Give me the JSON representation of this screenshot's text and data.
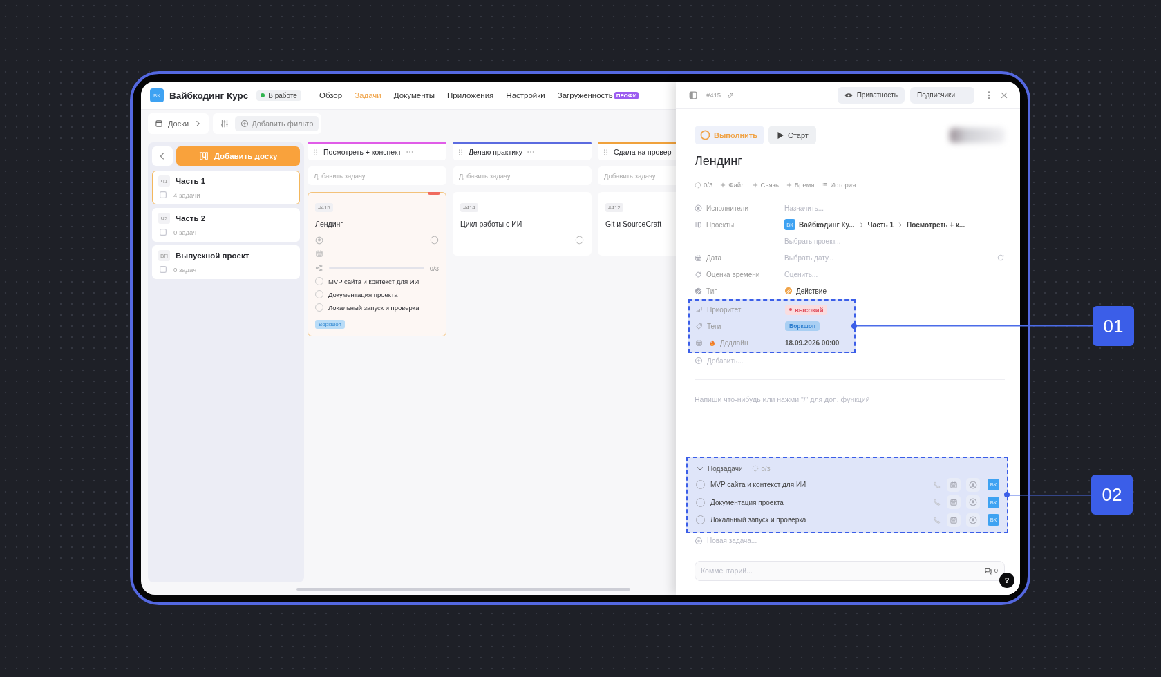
{
  "app": {
    "logo": "ВК",
    "title": "Вайбкодинг Курс",
    "status": "В работе",
    "nav": [
      {
        "label": "Обзор",
        "selected": false
      },
      {
        "label": "Задачи",
        "selected": true
      },
      {
        "label": "Документы",
        "selected": false
      },
      {
        "label": "Приложения",
        "selected": false
      },
      {
        "label": "Настройки",
        "selected": false
      },
      {
        "label": "Загруженность",
        "selected": false,
        "badge": "ПРОФИ"
      }
    ]
  },
  "toolbar": {
    "boards": "Доски",
    "add_filter": "Добавить фильтр"
  },
  "sidebar": {
    "add_board": "Добавить доску",
    "boards": [
      {
        "abbr": "Ч1",
        "name": "Часть 1",
        "count": "4 задачи",
        "selected": true
      },
      {
        "abbr": "Ч2",
        "name": "Часть 2",
        "count": "0 задач",
        "selected": false
      },
      {
        "abbr": "ВП",
        "name": "Выпускной проект",
        "count": "0 задач",
        "selected": false
      }
    ]
  },
  "columns": [
    {
      "title": "Посмотреть + конспект",
      "color": "#e05ce8",
      "add_task": "Добавить задачу",
      "cards": [
        {
          "id": "#415",
          "title": "Лендинг",
          "selected": true,
          "progress": "0/3",
          "level": 0,
          "subtasks": [
            {
              "title": "MVP сайта и контекст для ИИ",
              "checked": false
            },
            {
              "title": "Документация проекта",
              "checked": false
            },
            {
              "title": "Локальный запуск и проверка",
              "checked": false
            }
          ],
          "tag": "Воркшоп"
        }
      ]
    },
    {
      "title": "Делаю практику",
      "color": "#5b6be0",
      "add_task": "Добавить задачу",
      "cards": [
        {
          "id": "#414",
          "title": "Цикл работы с ИИ",
          "selected": false
        }
      ]
    },
    {
      "title": "Сдала на провер",
      "color": "#f0a23c",
      "add_task": "Добавить задачу",
      "cards": [
        {
          "id": "#412",
          "title": "Git и SourceCraft",
          "selected": false
        }
      ]
    }
  ],
  "detail": {
    "id": "#415",
    "privacy": "Приватность",
    "subscribers": "Подписчики",
    "complete": "Выполнить",
    "start": "Старт",
    "title": "Лендинг",
    "actions": [
      {
        "kind": "progress",
        "label": "0/3"
      },
      {
        "kind": "add",
        "label": "Файл"
      },
      {
        "kind": "add",
        "label": "Связь"
      },
      {
        "kind": "add",
        "label": "Время"
      },
      {
        "kind": "history",
        "label": "История"
      }
    ],
    "properties": [
      {
        "kind": "assignees",
        "label": "Исполнители",
        "value": "Назначить...",
        "empty": true
      },
      {
        "kind": "projects",
        "label": "Проекты",
        "logo": "ВК",
        "path": [
          "Вайбкодинг Ку...",
          "Часть 1",
          "Посмотреть + к..."
        ],
        "extra": "Выбрать проект..."
      },
      {
        "kind": "date",
        "label": "Дата",
        "value": "Выбрать дату...",
        "empty": true
      },
      {
        "kind": "estimate",
        "label": "Оценка времени",
        "value": "Оценить...",
        "empty": true
      },
      {
        "kind": "type",
        "label": "Тип",
        "value": "Действие",
        "empty": false
      }
    ],
    "callout_group": {
      "callout": "01",
      "properties": [
        {
          "kind": "priority",
          "label": "Приоритет",
          "value": "высокий"
        },
        {
          "kind": "tags",
          "label": "Теги",
          "value": "Воркшоп"
        },
        {
          "kind": "deadline",
          "label": "Дедлайн",
          "value": "18.09.2026 00:00"
        }
      ]
    },
    "add_property": "Добавить...",
    "editor": {
      "placeholder": "Напиши что-нибудь или нажми \"/\" для доп. функций"
    },
    "subtasks": {
      "callout": "02",
      "title": "Подзадачи",
      "expanded": true,
      "progress": "0/3",
      "items": [
        {
          "title": "MVP сайта и контекст для ИИ",
          "checked": false,
          "owner": "ВК"
        },
        {
          "title": "Документация проекта",
          "checked": false,
          "owner": "ВК"
        },
        {
          "title": "Локальный запуск и проверка",
          "checked": false,
          "owner": "ВК"
        }
      ]
    },
    "new_task": "Новая задача...",
    "comment": {
      "placeholder": "Комментарий...",
      "count": "0"
    },
    "help": "?"
  }
}
